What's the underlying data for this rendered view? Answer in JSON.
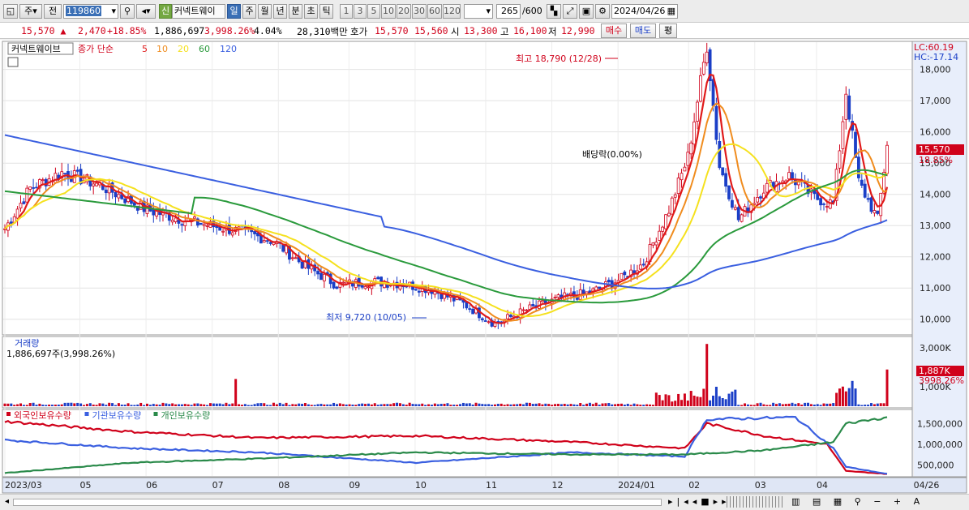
{
  "toolbar": {
    "mode1": "주",
    "mode2": "전",
    "code": "119860",
    "sin": "신",
    "name": "커넥트웨이",
    "periods": [
      "일",
      "주",
      "월",
      "년",
      "분",
      "초",
      "틱"
    ],
    "minutes": [
      "1",
      "3",
      "5",
      "10",
      "20",
      "30",
      "60",
      "120"
    ],
    "count": "265",
    "count_total": "/600",
    "date": "2024/04/26"
  },
  "quote": {
    "price": "15,570",
    "arrow": "▲",
    "change": "2,470",
    "change_pct": "+18.85%",
    "volume": "1,886,697",
    "volume_pct": "3,998.26%",
    "turnover": "4.04%",
    "amount": "28,310백만",
    "hoga_label": "호가",
    "ask": "15,570",
    "bid": "15,560",
    "open_label": "시",
    "open": "13,300",
    "high_label": "고",
    "high": "16,100",
    "low_label": "저",
    "low": "12,990",
    "buy": "매수",
    "sell": "매도",
    "avg": "평"
  },
  "price_panel": {
    "name_tag": "커넥트웨이브",
    "legend_label": "종가 단순",
    "ma_periods": [
      "5",
      "10",
      "20",
      "60",
      "120"
    ],
    "ma_colors": [
      "#e01a1a",
      "#f08c1e",
      "#f5e11e",
      "#2a9a3c",
      "#3a5fe0"
    ],
    "lc": "LC:60.19",
    "hc": "HC:-17.14",
    "high_note": "최고 18,790 (12/28)",
    "low_note": "최저 9,720 (10/05)",
    "dividend_note": "배당락(0.00%)",
    "current_tag": "15,570",
    "current_pct": "18.85%",
    "y_ticks": [
      "18,000",
      "17,000",
      "16,000",
      "15,000",
      "14,000",
      "13,000",
      "12,000",
      "11,000",
      "10,000"
    ]
  },
  "volume_panel": {
    "title": "거래량",
    "value": "1,886,697주(3,998.26%)",
    "tag": "1,887K",
    "tag_pct": "3998.26%",
    "y_ticks": [
      "3,000K",
      "1,000K"
    ]
  },
  "holding_panel": {
    "legend": [
      "외국인보유수량",
      "기관보유수량",
      "개인보유수량"
    ],
    "colors": [
      "#d0021b",
      "#3a5fe0",
      "#2a8a4a"
    ],
    "y_ticks": [
      "1,500,000",
      "1,000,000",
      "500,000"
    ]
  },
  "x_axis": [
    "2023/03",
    "05",
    "06",
    "07",
    "08",
    "09",
    "10",
    "11",
    "12",
    "2024/01",
    "02",
    "03",
    "04",
    "04/26"
  ],
  "colors": {
    "up": "#d0021b",
    "down": "#1b3fc7",
    "selected": "#3a6fb6"
  },
  "chart_data": {
    "type": "line",
    "title": "커넥트웨이브",
    "ylim": [
      9500,
      18900
    ],
    "x": [
      "2023/03",
      "2023/05",
      "2023/06",
      "2023/07",
      "2023/08",
      "2023/09",
      "2023/10",
      "2023/11",
      "2023/12",
      "2024/01",
      "2024/02",
      "2024/03",
      "2024/04",
      "2024/04/26"
    ],
    "series": [
      {
        "name": "5",
        "values": [
          13000,
          14200,
          13800,
          13200,
          12600,
          11000,
          11200,
          10000,
          10700,
          11500,
          17000,
          14200,
          14500,
          13300,
          15570
        ]
      },
      {
        "name": "120",
        "values": [
          15900,
          15500,
          14900,
          14100,
          13300,
          12700,
          12000,
          11600,
          11400,
          11800,
          12300,
          12500,
          12900,
          13200,
          13400
        ]
      }
    ],
    "annotations": [
      "최고 18,790 (12/28)",
      "최저 9,720 (10/05)",
      "배당락(0.00%)"
    ]
  }
}
